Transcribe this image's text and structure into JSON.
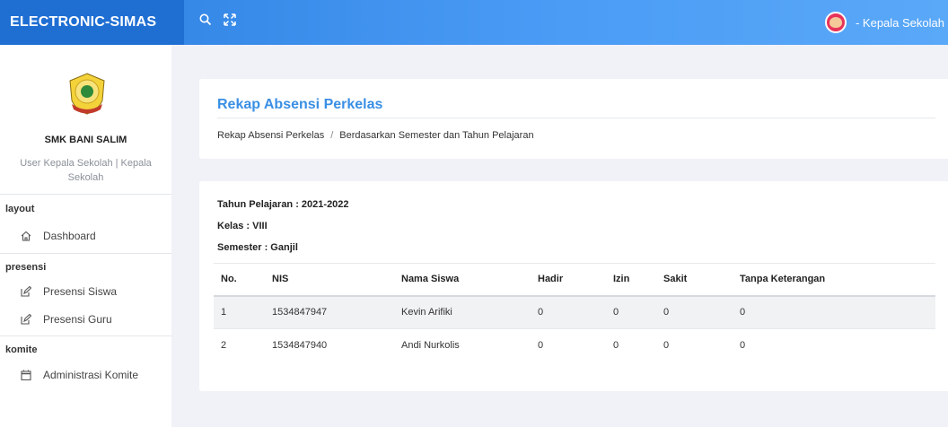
{
  "header": {
    "brand": "ELECTRONIC-SIMAS",
    "search_icon": "search-icon",
    "fullscreen_icon": "fullscreen-icon",
    "user_label": "- Kepala Sekolah"
  },
  "sidebar": {
    "school_name": "SMK BANI SALIM",
    "user_role": "User Kepala Sekolah | Kepala Sekolah",
    "sections": [
      {
        "label": "layout",
        "items": [
          {
            "label": "Dashboard",
            "icon": "home-icon"
          }
        ]
      },
      {
        "label": "presensi",
        "items": [
          {
            "label": "Presensi Siswa",
            "icon": "edit-icon"
          },
          {
            "label": "Presensi Guru",
            "icon": "edit-icon"
          }
        ]
      },
      {
        "label": "komite",
        "items": [
          {
            "label": "Administrasi Komite",
            "icon": "calendar-icon"
          }
        ]
      }
    ]
  },
  "page": {
    "title": "Rekap Absensi Perkelas",
    "breadcrumb": [
      "Rekap Absensi Perkelas",
      "/",
      "Berdasarkan Semester dan Tahun Pelajaran"
    ]
  },
  "report": {
    "tahun_pelajaran": "Tahun Pelajaran : 2021-2022",
    "kelas": "Kelas : VIII",
    "semester": "Semester : Ganjil",
    "columns": [
      "No.",
      "NIS",
      "Nama Siswa",
      "Hadir",
      "Izin",
      "Sakit",
      "Tanpa Keterangan"
    ],
    "rows": [
      [
        "1",
        "1534847947",
        "Kevin Arifiki",
        "0",
        "0",
        "0",
        "0"
      ],
      [
        "2",
        "1534847940",
        "Andi Nurkolis",
        "0",
        "0",
        "0",
        "0"
      ]
    ]
  },
  "colors": {
    "topbar": "#4a9cf5",
    "brand_bg": "#1f6fd3",
    "title_accent": "#3a8fe4"
  }
}
